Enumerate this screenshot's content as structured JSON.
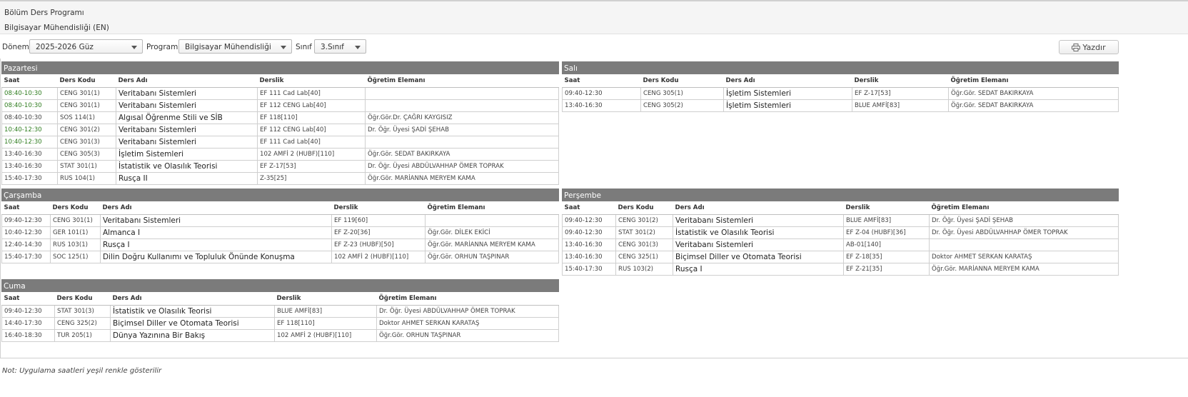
{
  "header": {
    "title": "Bölüm Ders Programı",
    "department": "Bilgisayar Mühendisliği (EN)"
  },
  "filters": {
    "term_label": "Dönem",
    "term_value": "2025-2026 Güz",
    "program_label": "Program",
    "program_value": "Bilgisayar Mühendisliği",
    "class_label": "Sınıf",
    "class_value": "3.Sınıf"
  },
  "print_label": "Yazdır",
  "columns": [
    "Saat",
    "Ders Kodu",
    "Ders Adı",
    "Derslik",
    "Öğretim Elemanı"
  ],
  "days": {
    "pazartesi": {
      "title": "Pazartesi",
      "rows": [
        {
          "saat": "08:40-10:30",
          "kod": "CENG 301(1)",
          "ad": "Veritabanı Sistemleri",
          "derslik": "EF 111 Cad Lab[40]",
          "hoca": "",
          "lab": true
        },
        {
          "saat": "08:40-10:30",
          "kod": "CENG 301(1)",
          "ad": "Veritabanı Sistemleri",
          "derslik": "EF 112 CENG Lab[40]",
          "hoca": "",
          "lab": true
        },
        {
          "saat": "08:40-10:30",
          "kod": "SOS 114(1)",
          "ad": "Algısal Öğrenme Stili ve SİB",
          "derslik": "EF 118[110]",
          "hoca": "Öğr.Gör.Dr. ÇAĞRI KAYGISIZ",
          "lab": false
        },
        {
          "saat": "10:40-12:30",
          "kod": "CENG 301(2)",
          "ad": "Veritabanı Sistemleri",
          "derslik": "EF 112 CENG Lab[40]",
          "hoca": "Dr. Öğr. Üyesi ŞADİ ŞEHAB",
          "lab": true
        },
        {
          "saat": "10:40-12:30",
          "kod": "CENG 301(3)",
          "ad": "Veritabanı Sistemleri",
          "derslik": "EF 111 Cad Lab[40]",
          "hoca": "",
          "lab": true
        },
        {
          "saat": "13:40-16:30",
          "kod": "CENG 305(3)",
          "ad": "İşletim Sistemleri",
          "derslik": "102 AMFİ 2 (HUBF)[110]",
          "hoca": "Öğr.Gör. SEDAT BAKIRKAYA",
          "lab": false
        },
        {
          "saat": "13:40-16:30",
          "kod": "STAT 301(1)",
          "ad": "İstatistik ve Olasılık Teorisi",
          "derslik": "EF Z-17[53]",
          "hoca": "Dr. Öğr. Üyesi ABDÜLVAHHAP ÖMER TOPRAK",
          "lab": false
        },
        {
          "saat": "15:40-17:30",
          "kod": "RUS 104(1)",
          "ad": "Rusça II",
          "derslik": "Z-35[25]",
          "hoca": "Öğr.Gör. MARİANNA MERYEM KAMA",
          "lab": false
        }
      ]
    },
    "sali": {
      "title": "Salı",
      "rows": [
        {
          "saat": "09:40-12:30",
          "kod": "CENG 305(1)",
          "ad": "İşletim Sistemleri",
          "derslik": "EF Z-17[53]",
          "hoca": "Öğr.Gör. SEDAT BAKIRKAYA",
          "lab": false
        },
        {
          "saat": "13:40-16:30",
          "kod": "CENG 305(2)",
          "ad": "İşletim Sistemleri",
          "derslik": "BLUE AMFİ[83]",
          "hoca": "Öğr.Gör. SEDAT BAKIRKAYA",
          "lab": false
        }
      ]
    },
    "carsamba": {
      "title": "Çarşamba",
      "rows": [
        {
          "saat": "09:40-12:30",
          "kod": "CENG 301(1)",
          "ad": "Veritabanı Sistemleri",
          "derslik": "EF 119[60]",
          "hoca": "",
          "lab": false
        },
        {
          "saat": "10:40-12:30",
          "kod": "GER 101(1)",
          "ad": "Almanca I",
          "derslik": "EF Z-20[36]",
          "hoca": "Öğr.Gör. DİLEK EKİCİ",
          "lab": false
        },
        {
          "saat": "12:40-14:30",
          "kod": "RUS 103(1)",
          "ad": "Rusça I",
          "derslik": "EF Z-23 (HUBF)[50]",
          "hoca": "Öğr.Gör. MARİANNA MERYEM KAMA",
          "lab": false
        },
        {
          "saat": "15:40-17:30",
          "kod": "SOC 125(1)",
          "ad": "Dilin Doğru Kullanımı ve Topluluk Önünde Konuşma",
          "derslik": "102 AMFİ 2 (HUBF)[110]",
          "hoca": "Öğr.Gör. ORHUN TAŞPINAR",
          "lab": false
        }
      ]
    },
    "persembe": {
      "title": "Perşembe",
      "rows": [
        {
          "saat": "09:40-12:30",
          "kod": "CENG 301(2)",
          "ad": "Veritabanı Sistemleri",
          "derslik": "BLUE AMFİ[83]",
          "hoca": "Dr. Öğr. Üyesi ŞADİ ŞEHAB",
          "lab": false
        },
        {
          "saat": "09:40-12:30",
          "kod": "STAT 301(2)",
          "ad": "İstatistik ve Olasılık Teorisi",
          "derslik": "EF Z-04 (HUBF)[36]",
          "hoca": "Dr. Öğr. Üyesi ABDÜLVAHHAP ÖMER TOPRAK",
          "lab": false
        },
        {
          "saat": "13:40-16:30",
          "kod": "CENG 301(3)",
          "ad": "Veritabanı Sistemleri",
          "derslik": "AB-01[140]",
          "hoca": "",
          "lab": false
        },
        {
          "saat": "13:40-16:30",
          "kod": "CENG 325(1)",
          "ad": "Biçimsel Diller ve Otomata Teorisi",
          "derslik": "EF Z-18[35]",
          "hoca": "Doktor AHMET SERKAN KARATAŞ",
          "lab": false
        },
        {
          "saat": "15:40-17:30",
          "kod": "RUS 103(2)",
          "ad": "Rusça I",
          "derslik": "EF Z-21[35]",
          "hoca": "Öğr.Gör. MARİANNA MERYEM KAMA",
          "lab": false
        }
      ]
    },
    "cuma": {
      "title": "Cuma",
      "rows": [
        {
          "saat": "09:40-12:30",
          "kod": "STAT 301(3)",
          "ad": "İstatistik ve Olasılık Teorisi",
          "derslik": "BLUE AMFİ[83]",
          "hoca": "Dr. Öğr. Üyesi ABDÜLVAHHAP ÖMER TOPRAK",
          "lab": false
        },
        {
          "saat": "14:40-17:30",
          "kod": "CENG 325(2)",
          "ad": "Biçimsel Diller ve Otomata Teorisi",
          "derslik": "EF 118[110]",
          "hoca": "Doktor AHMET SERKAN KARATAŞ",
          "lab": false
        },
        {
          "saat": "16:40-18:30",
          "kod": "TUR 205(1)",
          "ad": "Dünya Yazınına Bir Bakış",
          "derslik": "102 AMFİ 2 (HUBF)[110]",
          "hoca": "Öğr.Gör. ORHUN TAŞPINAR",
          "lab": false
        }
      ]
    }
  },
  "note": "Not: Uygulama saatleri yeşil renkle gösterilir",
  "colors": {
    "panel_header": "#7b7b7b",
    "lab_time": "#2f7d1f"
  }
}
